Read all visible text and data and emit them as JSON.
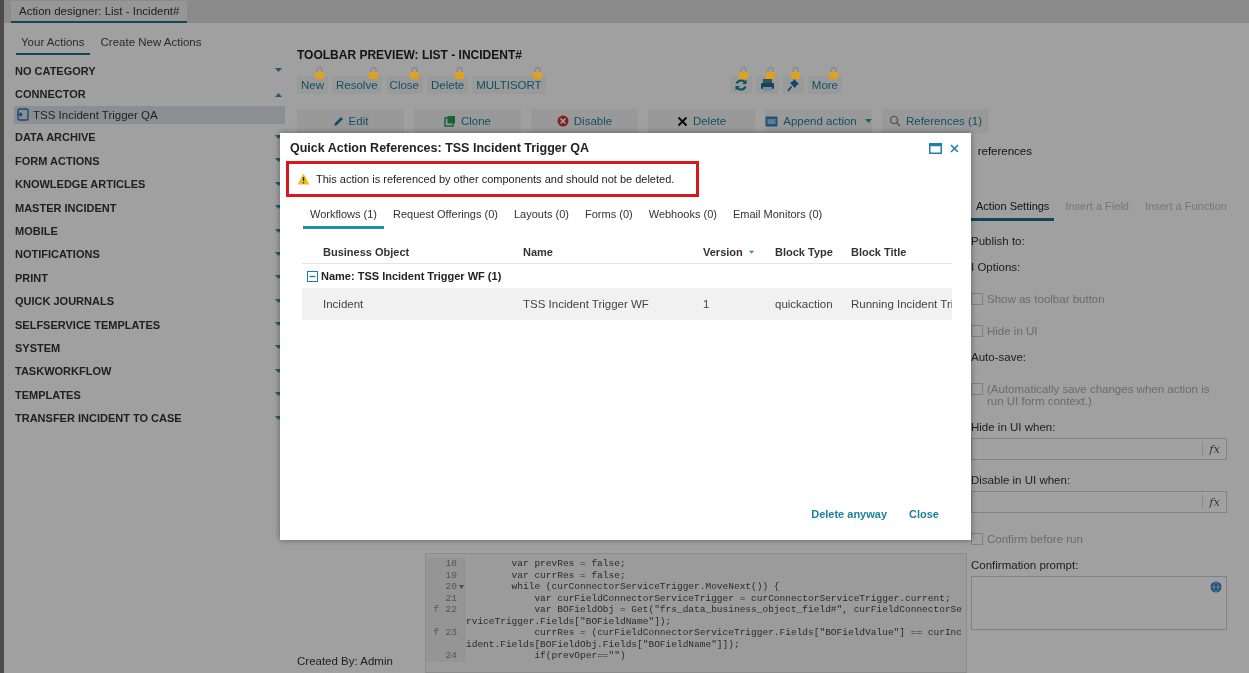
{
  "window_tab": {
    "label": "Action designer: List - Incident#",
    "selected": true
  },
  "sidebar": {
    "tabs": [
      {
        "label": "Your Actions",
        "selected": true
      },
      {
        "label": "Create New Actions",
        "selected": false
      }
    ],
    "categories": [
      {
        "label": "NO CATEGORY",
        "expanded": false
      },
      {
        "label": "CONNECTOR",
        "expanded": true,
        "children": [
          {
            "label": "TSS Incident Trigger QA",
            "selected": true
          }
        ]
      },
      {
        "label": "DATA ARCHIVE",
        "expanded": false
      },
      {
        "label": "FORM ACTIONS",
        "expanded": false
      },
      {
        "label": "KNOWLEDGE ARTICLES",
        "expanded": false
      },
      {
        "label": "MASTER INCIDENT",
        "expanded": false
      },
      {
        "label": "MOBILE",
        "expanded": false
      },
      {
        "label": "NOTIFICATIONS",
        "expanded": false
      },
      {
        "label": "PRINT",
        "expanded": false
      },
      {
        "label": "QUICK JOURNALS",
        "expanded": false
      },
      {
        "label": "SELFSERVICE TEMPLATES",
        "expanded": false
      },
      {
        "label": "SYSTEM",
        "expanded": false
      },
      {
        "label": "TASKWORKFLOW",
        "expanded": false
      },
      {
        "label": "TEMPLATES",
        "expanded": false
      },
      {
        "label": "TRANSFER INCIDENT TO CASE",
        "expanded": false
      }
    ]
  },
  "toolbar_preview": {
    "title": "TOOLBAR PREVIEW: LIST - INCIDENT#",
    "left_buttons": [
      {
        "kind": "text",
        "label": "New",
        "locked": true
      },
      {
        "kind": "text",
        "label": "Resolve",
        "locked": true
      },
      {
        "kind": "text",
        "label": "Close",
        "locked": true
      },
      {
        "kind": "text",
        "label": "Delete",
        "locked": true
      },
      {
        "kind": "text",
        "label": "MULTISORT",
        "locked": true
      }
    ],
    "right_buttons": [
      {
        "kind": "refresh",
        "locked": true
      },
      {
        "kind": "print",
        "locked": true
      },
      {
        "kind": "pin",
        "locked": true
      },
      {
        "kind": "text",
        "label": "More",
        "locked": true
      }
    ]
  },
  "actions": [
    {
      "kind": "edit",
      "label": "Edit"
    },
    {
      "kind": "clone",
      "label": "Clone"
    },
    {
      "kind": "disable",
      "label": "Disable"
    },
    {
      "kind": "delete",
      "label": "Delete"
    },
    {
      "kind": "append",
      "label": "Append action",
      "dropdown": true
    },
    {
      "kind": "search",
      "label": "References (1)"
    }
  ],
  "references_note": "references",
  "code_editor": {
    "lines": [
      {
        "number": "18",
        "text": "        var prevRes = false;"
      },
      {
        "number": "19",
        "text": "        var currRes = false;"
      },
      {
        "number": "20",
        "text": "        while (curConnectorServiceTrigger.MoveNext()) {",
        "fold": true
      },
      {
        "number": "21",
        "text": "            var curFieldConnectorServiceTrigger = curConnectorServiceTrigger.current;"
      },
      {
        "number": "22",
        "text": "            var BOFieldObj = Get(\"frs_data_business_object_field#\", curFieldConnectorServiceTrigger.Fields[\"BOFieldName\"]);",
        "mark": "f"
      },
      {
        "number": "23",
        "text": "            currRes = (curFieldConnectorServiceTrigger.Fields[\"BOFieldValue\"] == curIncident.Fields[BOFieldObj.Fields[\"BOFieldName\"]]);",
        "mark": "f"
      },
      {
        "number": "24",
        "text": "            if(prevOper==\"\")"
      }
    ]
  },
  "created_by": "Created By: Admin",
  "settings": {
    "tabs": [
      {
        "label": "Action Settings",
        "selected": true,
        "disabled": false
      },
      {
        "label": "Insert a Field",
        "selected": false,
        "disabled": true
      },
      {
        "label": "Insert a Function",
        "selected": false,
        "disabled": true
      }
    ],
    "fields": [
      {
        "kind": "label",
        "text": "Publish to:"
      },
      {
        "kind": "label",
        "text": "I Options:"
      },
      {
        "kind": "checkbox",
        "label": "Show as toolbar button",
        "checked": false,
        "disabled": true
      },
      {
        "kind": "checkbox",
        "label": "Hide in UI",
        "checked": false,
        "disabled": true
      },
      {
        "kind": "label",
        "text": "Auto-save:"
      },
      {
        "kind": "checkbox",
        "label": "(Automatically save changes when action is run UI form context.)",
        "checked": false,
        "disabled": true
      },
      {
        "kind": "formula",
        "label": "Hide in UI when:",
        "button": "fx"
      },
      {
        "kind": "formula",
        "label": "Disable in UI when:",
        "button": "fx"
      },
      {
        "kind": "checkbox",
        "label": "Confirm before run",
        "checked": false,
        "disabled": true
      },
      {
        "kind": "textarea",
        "label": "Confirmation prompt:"
      }
    ]
  },
  "dialog": {
    "title": "Quick Action References: TSS Incident Trigger QA",
    "warning": "This action is referenced by other components and should not be deleted.",
    "tabs": [
      {
        "label": "Workflows (1)",
        "selected": true
      },
      {
        "label": "Request Offerings (0)",
        "selected": false
      },
      {
        "label": "Layouts (0)",
        "selected": false
      },
      {
        "label": "Forms (0)",
        "selected": false
      },
      {
        "label": "Webhooks (0)",
        "selected": false
      },
      {
        "label": "Email Monitors (0)",
        "selected": false
      }
    ],
    "table": {
      "columns": [
        {
          "label": "Business Object",
          "sorted": false
        },
        {
          "label": "Name",
          "sorted": false
        },
        {
          "label": "Version",
          "sorted": true
        },
        {
          "label": "Block Type",
          "sorted": false
        },
        {
          "label": "Block Title",
          "sorted": false
        }
      ],
      "groups": [
        {
          "label": "Name: TSS Incident Trigger WF (1)",
          "expanded": true,
          "rows": [
            {
              "cells": [
                "Incident",
                "TSS Incident Trigger WF",
                "1",
                "quickaction",
                "Running Incident Tri"
              ],
              "selected": true
            }
          ]
        }
      ]
    },
    "buttons": [
      "Delete anyway",
      "Close"
    ]
  }
}
